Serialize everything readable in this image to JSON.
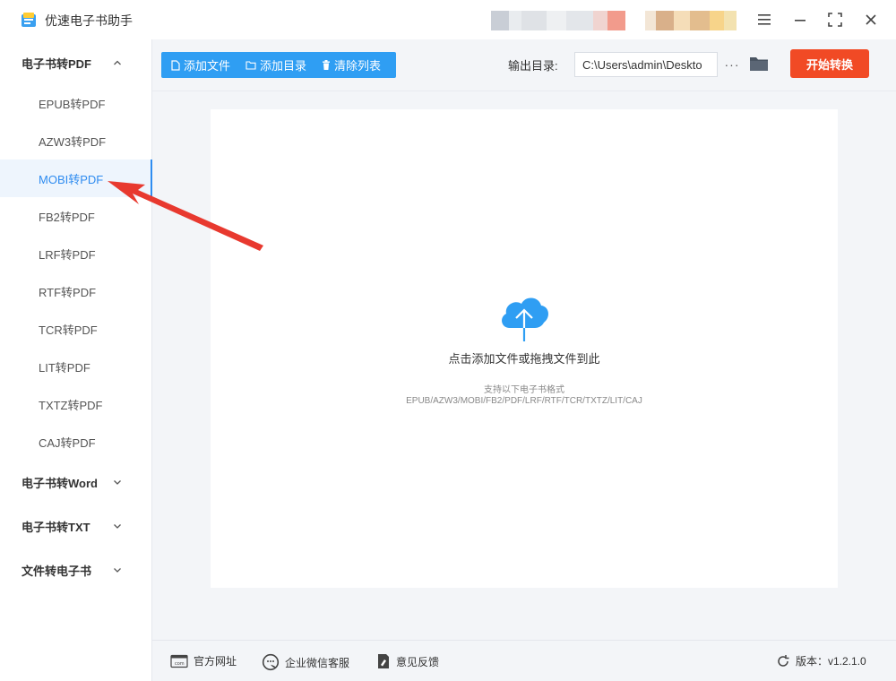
{
  "app": {
    "title": "优速电子书助手"
  },
  "window_controls": [
    "menu-icon",
    "minimize-icon",
    "maximize-icon",
    "close-icon"
  ],
  "sidebar": {
    "groups": [
      {
        "label": "电子书转PDF",
        "expanded": true
      },
      {
        "label": "电子书转Word",
        "expanded": false
      },
      {
        "label": "电子书转TXT",
        "expanded": false
      },
      {
        "label": "文件转电子书",
        "expanded": false
      }
    ],
    "items": [
      {
        "label": "EPUB转PDF"
      },
      {
        "label": "AZW3转PDF"
      },
      {
        "label": "MOBI转PDF",
        "active": true
      },
      {
        "label": "FB2转PDF"
      },
      {
        "label": "LRF转PDF"
      },
      {
        "label": "RTF转PDF"
      },
      {
        "label": "TCR转PDF"
      },
      {
        "label": "LIT转PDF"
      },
      {
        "label": "TXTZ转PDF"
      },
      {
        "label": "CAJ转PDF"
      }
    ]
  },
  "toolbar": {
    "add_file": "添加文件",
    "add_folder": "添加目录",
    "clear_list": "清除列表",
    "output_label": "输出目录:",
    "output_path": "C:\\Users\\admin\\Deskto",
    "more": "···",
    "start": "开始转换"
  },
  "drop": {
    "main": "点击添加文件或拖拽文件到此",
    "sub": "支持以下电子书格式",
    "formats": "EPUB/AZW3/MOBI/FB2/PDF/LRF/RTF/TCR/TXTZ/LIT/CAJ"
  },
  "footer": {
    "website": "官方网址",
    "wechat": "企业微信客服",
    "feedback": "意见反馈",
    "version": "版本：v1.2.1.0"
  },
  "colors": {
    "accent": "#2f8cf0",
    "toolbar_button": "#2f9ef3",
    "start_button": "#f14a25",
    "annotation_arrow": "#e8392f"
  }
}
